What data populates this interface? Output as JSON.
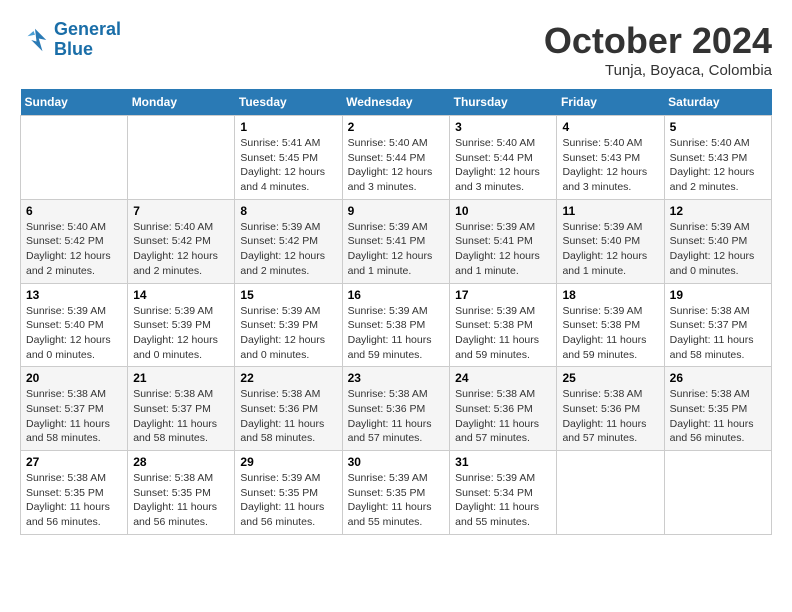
{
  "logo": {
    "line1": "General",
    "line2": "Blue"
  },
  "title": "October 2024",
  "subtitle": "Tunja, Boyaca, Colombia",
  "weekdays": [
    "Sunday",
    "Monday",
    "Tuesday",
    "Wednesday",
    "Thursday",
    "Friday",
    "Saturday"
  ],
  "weeks": [
    [
      {
        "day": "",
        "info": ""
      },
      {
        "day": "",
        "info": ""
      },
      {
        "day": "1",
        "info": "Sunrise: 5:41 AM\nSunset: 5:45 PM\nDaylight: 12 hours and 4 minutes."
      },
      {
        "day": "2",
        "info": "Sunrise: 5:40 AM\nSunset: 5:44 PM\nDaylight: 12 hours and 3 minutes."
      },
      {
        "day": "3",
        "info": "Sunrise: 5:40 AM\nSunset: 5:44 PM\nDaylight: 12 hours and 3 minutes."
      },
      {
        "day": "4",
        "info": "Sunrise: 5:40 AM\nSunset: 5:43 PM\nDaylight: 12 hours and 3 minutes."
      },
      {
        "day": "5",
        "info": "Sunrise: 5:40 AM\nSunset: 5:43 PM\nDaylight: 12 hours and 2 minutes."
      }
    ],
    [
      {
        "day": "6",
        "info": "Sunrise: 5:40 AM\nSunset: 5:42 PM\nDaylight: 12 hours and 2 minutes."
      },
      {
        "day": "7",
        "info": "Sunrise: 5:40 AM\nSunset: 5:42 PM\nDaylight: 12 hours and 2 minutes."
      },
      {
        "day": "8",
        "info": "Sunrise: 5:39 AM\nSunset: 5:42 PM\nDaylight: 12 hours and 2 minutes."
      },
      {
        "day": "9",
        "info": "Sunrise: 5:39 AM\nSunset: 5:41 PM\nDaylight: 12 hours and 1 minute."
      },
      {
        "day": "10",
        "info": "Sunrise: 5:39 AM\nSunset: 5:41 PM\nDaylight: 12 hours and 1 minute."
      },
      {
        "day": "11",
        "info": "Sunrise: 5:39 AM\nSunset: 5:40 PM\nDaylight: 12 hours and 1 minute."
      },
      {
        "day": "12",
        "info": "Sunrise: 5:39 AM\nSunset: 5:40 PM\nDaylight: 12 hours and 0 minutes."
      }
    ],
    [
      {
        "day": "13",
        "info": "Sunrise: 5:39 AM\nSunset: 5:40 PM\nDaylight: 12 hours and 0 minutes."
      },
      {
        "day": "14",
        "info": "Sunrise: 5:39 AM\nSunset: 5:39 PM\nDaylight: 12 hours and 0 minutes."
      },
      {
        "day": "15",
        "info": "Sunrise: 5:39 AM\nSunset: 5:39 PM\nDaylight: 12 hours and 0 minutes."
      },
      {
        "day": "16",
        "info": "Sunrise: 5:39 AM\nSunset: 5:38 PM\nDaylight: 11 hours and 59 minutes."
      },
      {
        "day": "17",
        "info": "Sunrise: 5:39 AM\nSunset: 5:38 PM\nDaylight: 11 hours and 59 minutes."
      },
      {
        "day": "18",
        "info": "Sunrise: 5:39 AM\nSunset: 5:38 PM\nDaylight: 11 hours and 59 minutes."
      },
      {
        "day": "19",
        "info": "Sunrise: 5:38 AM\nSunset: 5:37 PM\nDaylight: 11 hours and 58 minutes."
      }
    ],
    [
      {
        "day": "20",
        "info": "Sunrise: 5:38 AM\nSunset: 5:37 PM\nDaylight: 11 hours and 58 minutes."
      },
      {
        "day": "21",
        "info": "Sunrise: 5:38 AM\nSunset: 5:37 PM\nDaylight: 11 hours and 58 minutes."
      },
      {
        "day": "22",
        "info": "Sunrise: 5:38 AM\nSunset: 5:36 PM\nDaylight: 11 hours and 58 minutes."
      },
      {
        "day": "23",
        "info": "Sunrise: 5:38 AM\nSunset: 5:36 PM\nDaylight: 11 hours and 57 minutes."
      },
      {
        "day": "24",
        "info": "Sunrise: 5:38 AM\nSunset: 5:36 PM\nDaylight: 11 hours and 57 minutes."
      },
      {
        "day": "25",
        "info": "Sunrise: 5:38 AM\nSunset: 5:36 PM\nDaylight: 11 hours and 57 minutes."
      },
      {
        "day": "26",
        "info": "Sunrise: 5:38 AM\nSunset: 5:35 PM\nDaylight: 11 hours and 56 minutes."
      }
    ],
    [
      {
        "day": "27",
        "info": "Sunrise: 5:38 AM\nSunset: 5:35 PM\nDaylight: 11 hours and 56 minutes."
      },
      {
        "day": "28",
        "info": "Sunrise: 5:38 AM\nSunset: 5:35 PM\nDaylight: 11 hours and 56 minutes."
      },
      {
        "day": "29",
        "info": "Sunrise: 5:39 AM\nSunset: 5:35 PM\nDaylight: 11 hours and 56 minutes."
      },
      {
        "day": "30",
        "info": "Sunrise: 5:39 AM\nSunset: 5:35 PM\nDaylight: 11 hours and 55 minutes."
      },
      {
        "day": "31",
        "info": "Sunrise: 5:39 AM\nSunset: 5:34 PM\nDaylight: 11 hours and 55 minutes."
      },
      {
        "day": "",
        "info": ""
      },
      {
        "day": "",
        "info": ""
      }
    ]
  ]
}
